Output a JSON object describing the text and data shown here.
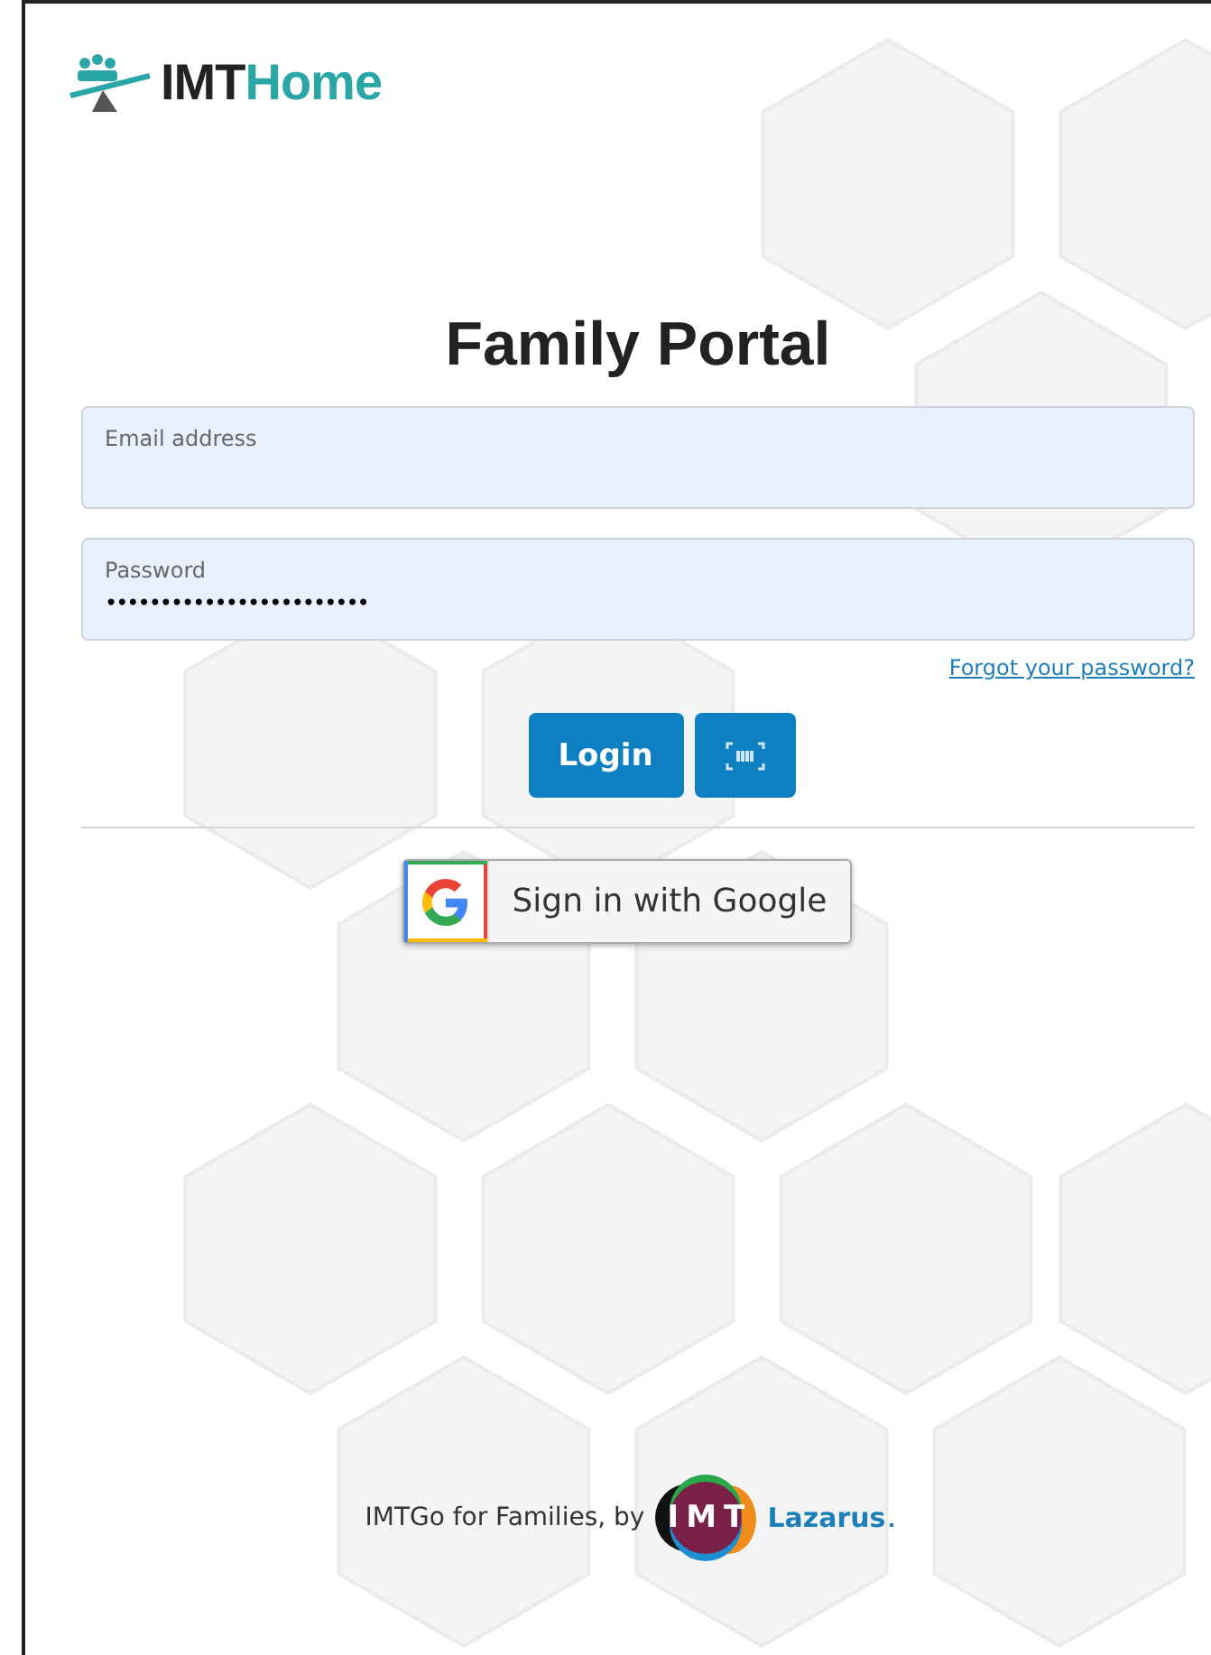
{
  "logo": {
    "brand": "IMT",
    "suffix": "Home"
  },
  "title": "Family Portal",
  "fields": [
    {
      "label": "Email address"
    },
    {
      "label": "Password",
      "value": "••••••••••••••••••••••••"
    }
  ],
  "forgot_link": "Forgot your password?",
  "login_button": "Login",
  "google_button": "Sign in with Google",
  "footer": {
    "text": "IMTGo for Families, by",
    "logo_letters": [
      "I",
      "M",
      "T"
    ],
    "partner": "Lazarus"
  }
}
